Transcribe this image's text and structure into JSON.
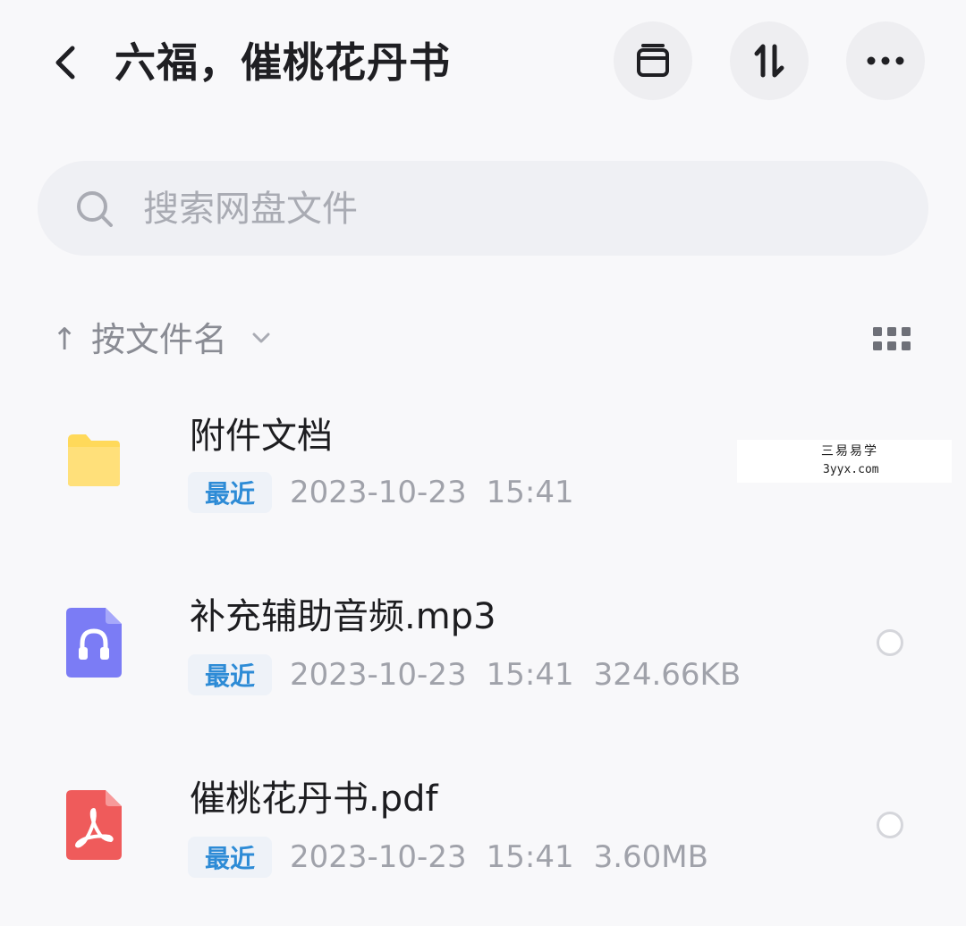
{
  "header": {
    "title": "六福，催桃花丹书",
    "icons": [
      "back-icon",
      "archive-icon",
      "sort-toggle-icon",
      "more-icon"
    ]
  },
  "search": {
    "placeholder": "搜索网盘文件",
    "icon": "search-icon"
  },
  "sort": {
    "arrow": "↑",
    "label": "按文件名",
    "icon": "chevron-down-icon",
    "view_icon": "grid-view-icon"
  },
  "files": [
    {
      "name": "附件文档",
      "badge": "最近",
      "date": "2023-10-23",
      "time": "15:41",
      "size": "",
      "type": "folder",
      "color": "#ffd95a"
    },
    {
      "name": "补充辅助音频.mp3",
      "badge": "最近",
      "date": "2023-10-23",
      "time": "15:41",
      "size": "324.66KB",
      "type": "audio",
      "color": "#7b7cf5"
    },
    {
      "name": "催桃花丹书.pdf",
      "badge": "最近",
      "date": "2023-10-23",
      "time": "15:41",
      "size": "3.60MB",
      "type": "pdf",
      "color": "#ef5b5b"
    }
  ],
  "watermark": {
    "line1": "三易易学",
    "line2": "3yyx.com"
  },
  "colors": {
    "accent": "#2d8bd6",
    "background": "#f8f8fa"
  }
}
